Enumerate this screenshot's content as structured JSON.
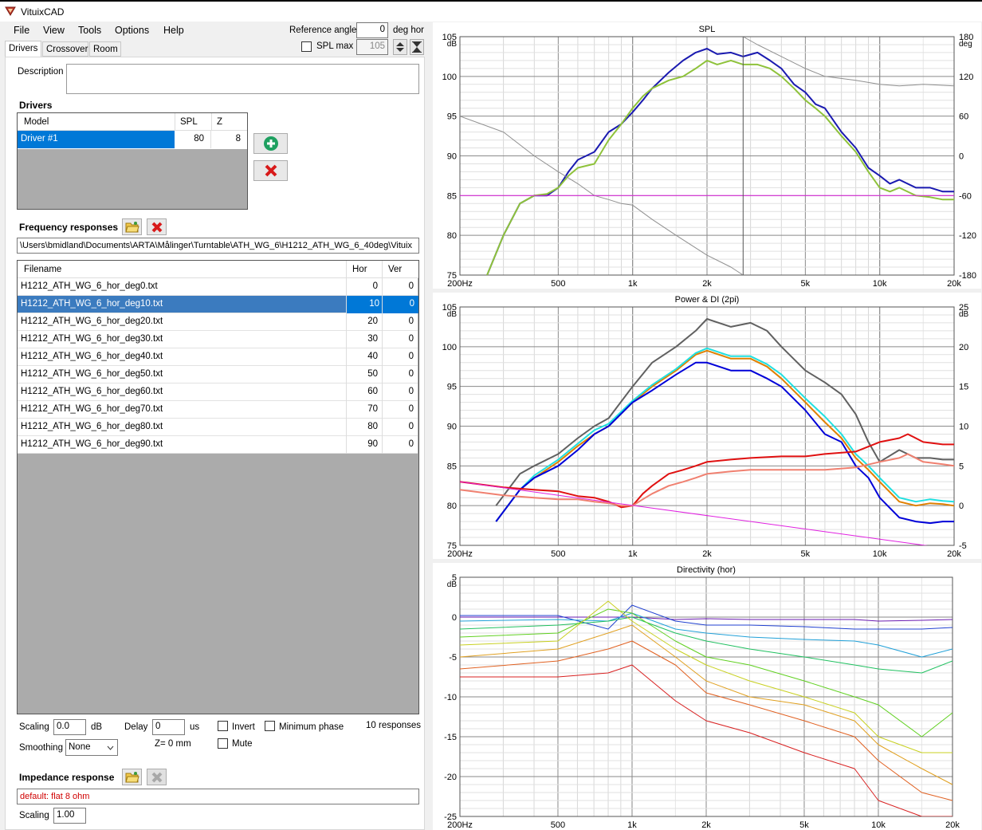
{
  "window": {
    "title": "VituixCAD"
  },
  "menu": [
    "File",
    "View",
    "Tools",
    "Options",
    "Help"
  ],
  "toolbar": {
    "ref_angle_label": "Reference angle",
    "ref_angle_value": "0",
    "ref_angle_unit": "deg hor",
    "spl_max_label": "SPL max",
    "spl_max_value": "105"
  },
  "tabs": [
    "Drivers",
    "Crossover",
    "Room"
  ],
  "description": {
    "label": "Description",
    "value": ""
  },
  "drivers": {
    "heading": "Drivers",
    "columns": [
      "Model",
      "SPL",
      "Z"
    ],
    "rows": [
      {
        "model": "Driver #1",
        "spl": "80",
        "z": "8"
      }
    ]
  },
  "freq": {
    "heading": "Frequency responses",
    "path": "\\Users\\bmidland\\Documents\\ARTA\\Målinger\\Turntable\\ATH_WG_6\\H1212_ATH_WG_6_40deg\\Vituix",
    "columns": [
      "Filename",
      "Hor",
      "Ver"
    ],
    "rows": [
      {
        "file": "H1212_ATH_WG_6_hor_deg0.txt",
        "hor": "0",
        "ver": "0"
      },
      {
        "file": "H1212_ATH_WG_6_hor_deg10.txt",
        "hor": "10",
        "ver": "0"
      },
      {
        "file": "H1212_ATH_WG_6_hor_deg20.txt",
        "hor": "20",
        "ver": "0"
      },
      {
        "file": "H1212_ATH_WG_6_hor_deg30.txt",
        "hor": "30",
        "ver": "0"
      },
      {
        "file": "H1212_ATH_WG_6_hor_deg40.txt",
        "hor": "40",
        "ver": "0"
      },
      {
        "file": "H1212_ATH_WG_6_hor_deg50.txt",
        "hor": "50",
        "ver": "0"
      },
      {
        "file": "H1212_ATH_WG_6_hor_deg60.txt",
        "hor": "60",
        "ver": "0"
      },
      {
        "file": "H1212_ATH_WG_6_hor_deg70.txt",
        "hor": "70",
        "ver": "0"
      },
      {
        "file": "H1212_ATH_WG_6_hor_deg80.txt",
        "hor": "80",
        "ver": "0"
      },
      {
        "file": "H1212_ATH_WG_6_hor_deg90.txt",
        "hor": "90",
        "ver": "0"
      }
    ]
  },
  "controls": {
    "scaling_label": "Scaling",
    "scaling_value": "0.0",
    "scaling_unit": "dB",
    "delay_label": "Delay",
    "delay_value": "0",
    "delay_unit": "us",
    "invert_label": "Invert",
    "minphase_label": "Minimum phase",
    "responses_count": "10 responses",
    "smoothing_label": "Smoothing",
    "smoothing_value": "None",
    "z_text": "Z= 0 mm",
    "mute_label": "Mute"
  },
  "impedance": {
    "heading": "Impedance response",
    "value": "default: flat 8 ohm",
    "scaling_label": "Scaling",
    "scaling_value": "1.00"
  },
  "colors": {
    "accent": "#3b7bbf",
    "selected_driver": "#0078d7",
    "red_text": "#d00000"
  },
  "chart_data": [
    {
      "type": "line",
      "title": "SPL",
      "xscale": "log",
      "xlim": [
        200,
        20000
      ],
      "xticks": [
        "200Hz",
        "500",
        "1k",
        "2k",
        "5k",
        "10k",
        "20k"
      ],
      "ylim": [
        75,
        105
      ],
      "yticks": [
        "105",
        "100",
        "95",
        "90",
        "85",
        "80",
        "75"
      ],
      "yunit": "dB",
      "y2lim": [
        -180,
        180
      ],
      "y2ticks": [
        "180",
        "120",
        "60",
        "0",
        "-60",
        "-120",
        "-180"
      ],
      "y2unit": "deg",
      "series": [
        {
          "color": "#1a1ab0",
          "x": [
            250,
            300,
            350,
            400,
            450,
            500,
            550,
            600,
            700,
            800,
            900,
            1000,
            1100,
            1200,
            1400,
            1600,
            1800,
            2000,
            2200,
            2500,
            2800,
            3200,
            3600,
            4000,
            4500,
            5000,
            5500,
            6000,
            7000,
            8000,
            9000,
            10000,
            11000,
            12000,
            14000,
            16000,
            18000,
            20000
          ],
          "y": [
            74,
            80,
            84,
            85,
            85,
            86,
            88,
            89.5,
            90.5,
            93,
            94,
            95.5,
            97,
            98.5,
            100.5,
            102,
            103,
            103.5,
            102.8,
            103,
            102.5,
            103,
            102,
            101,
            99,
            98,
            96.5,
            96,
            93,
            91,
            88.5,
            87.5,
            86.5,
            87,
            86,
            86,
            85.5,
            85.5
          ]
        },
        {
          "color": "#8ec23a",
          "x": [
            250,
            300,
            350,
            400,
            450,
            500,
            550,
            600,
            700,
            800,
            900,
            1000,
            1100,
            1200,
            1400,
            1600,
            1800,
            2000,
            2200,
            2500,
            2800,
            3200,
            3600,
            4000,
            4500,
            5000,
            5500,
            6000,
            7000,
            8000,
            9000,
            10000,
            11000,
            12000,
            14000,
            16000,
            18000,
            20000
          ],
          "y": [
            74,
            80,
            84,
            85,
            85.2,
            86,
            87.5,
            88.5,
            89,
            92,
            94,
            96,
            97.5,
            98.5,
            99.5,
            100,
            101,
            102,
            101.5,
            102,
            101.5,
            101.5,
            101,
            100,
            98.5,
            97,
            96,
            95,
            92.5,
            90.5,
            88,
            86,
            85.5,
            86,
            85,
            84.8,
            84.5,
            84.5
          ]
        },
        {
          "color": "#909090",
          "x": [
            200,
            300,
            400,
            500,
            600,
            700,
            800,
            900,
            1000,
            1200,
            1500,
            2000,
            2500,
            2800
          ],
          "y": [
            95,
            93,
            90,
            88,
            86.5,
            85,
            84.5,
            84,
            83.8,
            82,
            80,
            77.5,
            76,
            75
          ]
        },
        {
          "color": "#909090",
          "x": [
            2800,
            3200,
            4000,
            5000,
            6000,
            8000,
            10000,
            12000,
            15000,
            20000
          ],
          "y": [
            105,
            104,
            102.5,
            101,
            100,
            99.5,
            99,
            98.8,
            99,
            98.8
          ]
        },
        {
          "color": "#e020e0",
          "x": [
            200,
            20000
          ],
          "y": [
            85,
            85
          ]
        }
      ]
    },
    {
      "type": "line",
      "title": "Power & DI (2pi)",
      "xscale": "log",
      "xlim": [
        200,
        20000
      ],
      "xticks": [
        "200Hz",
        "500",
        "1k",
        "2k",
        "5k",
        "10k",
        "20k"
      ],
      "ylim": [
        75,
        105
      ],
      "yticks": [
        "105",
        "100",
        "95",
        "90",
        "85",
        "80",
        "75"
      ],
      "yunit": "dB",
      "y2lim": [
        -5,
        25
      ],
      "y2ticks": [
        "25",
        "20",
        "15",
        "10",
        "5",
        "0",
        "-5"
      ],
      "y2unit": "dB",
      "series": [
        {
          "color": "#606060",
          "x": [
            280,
            350,
            400,
            500,
            600,
            700,
            800,
            1000,
            1200,
            1500,
            1800,
            2000,
            2500,
            3000,
            3500,
            4000,
            5000,
            6000,
            7000,
            8000,
            9000,
            10000,
            12000,
            14000,
            16000,
            18000,
            20000
          ],
          "y": [
            80,
            84,
            85,
            86.5,
            88.5,
            90,
            91,
            95,
            98,
            100,
            102,
            103.5,
            102.5,
            103,
            102,
            100,
            97,
            95.5,
            94,
            91.5,
            88,
            85.5,
            87,
            86,
            86,
            85.8,
            85.8
          ]
        },
        {
          "color": "#e08000",
          "x": [
            280,
            350,
            400,
            500,
            600,
            700,
            800,
            1000,
            1200,
            1500,
            1800,
            2000,
            2500,
            3000,
            3500,
            4000,
            5000,
            6000,
            7000,
            8000,
            9000,
            10000,
            12000,
            14000,
            16000,
            18000,
            20000
          ],
          "y": [
            78,
            82,
            83.5,
            85.5,
            87.5,
            89,
            90,
            93,
            95,
            97,
            99,
            99.5,
            98.5,
            98.5,
            97.5,
            96,
            93,
            90.5,
            88.5,
            86,
            84.5,
            83,
            80.5,
            80,
            80.3,
            80.2,
            80
          ]
        },
        {
          "color": "#20e0e0",
          "x": [
            280,
            350,
            400,
            500,
            600,
            700,
            800,
            1000,
            1200,
            1500,
            1800,
            2000,
            2500,
            3000,
            3500,
            4000,
            5000,
            6000,
            7000,
            8000,
            9000,
            10000,
            12000,
            14000,
            16000,
            18000,
            20000
          ],
          "y": [
            78,
            82,
            83.8,
            85.8,
            87.8,
            89.5,
            90.3,
            93.2,
            95.2,
            97.2,
            99.2,
            99.8,
            98.8,
            98.8,
            97.8,
            96.5,
            93.5,
            91.2,
            89,
            86.5,
            85,
            83.5,
            81,
            80.5,
            80.8,
            80.6,
            80.5
          ]
        },
        {
          "color": "#0000d8",
          "x": [
            280,
            350,
            400,
            500,
            600,
            700,
            800,
            1000,
            1200,
            1500,
            1800,
            2000,
            2500,
            3000,
            3500,
            4000,
            5000,
            6000,
            7000,
            8000,
            9000,
            10000,
            12000,
            14000,
            16000,
            18000,
            20000
          ],
          "y": [
            78,
            82,
            83.5,
            85,
            87,
            89,
            90,
            93,
            94.5,
            96.5,
            98,
            98,
            97,
            97,
            96,
            95,
            92,
            89,
            88,
            85,
            83.5,
            81,
            78.5,
            78,
            77.8,
            78,
            78
          ]
        },
        {
          "color": "#e01010",
          "x": [
            200,
            300,
            400,
            500,
            600,
            700,
            800,
            900,
            1000,
            1100,
            1200,
            1400,
            1600,
            1800,
            2000,
            2500,
            3000,
            4000,
            5000,
            6000,
            8000,
            10000,
            12000,
            13000,
            15000,
            18000,
            20000
          ],
          "y": [
            83,
            82.3,
            82,
            81.8,
            81.2,
            81,
            80.5,
            79.8,
            80,
            81.5,
            82.5,
            84,
            84.5,
            85,
            85.5,
            85.8,
            86,
            86.2,
            86.2,
            86.5,
            86.8,
            88,
            88.5,
            89,
            88,
            87.7,
            87.7
          ]
        },
        {
          "color": "#f08070",
          "x": [
            200,
            300,
            400,
            500,
            600,
            700,
            800,
            900,
            1000,
            1100,
            1200,
            1400,
            1600,
            1800,
            2000,
            2500,
            3000,
            4000,
            5000,
            6000,
            8000,
            10000,
            12000,
            13000,
            15000,
            18000,
            20000
          ],
          "y": [
            82,
            81.3,
            81,
            80.8,
            80.8,
            80.5,
            80.3,
            80,
            80,
            80.8,
            81.5,
            82.5,
            83,
            83.5,
            84,
            84.3,
            84.5,
            84.5,
            84.5,
            84.5,
            84.8,
            85.5,
            86,
            86.5,
            85.5,
            85.2,
            85
          ]
        },
        {
          "color": "#e020e0",
          "x": [
            200,
            20000
          ],
          "y": [
            83,
            74.5
          ]
        }
      ]
    },
    {
      "type": "line",
      "title": "Directivity (hor)",
      "xscale": "log",
      "xlim": [
        200,
        20000
      ],
      "xticks": [
        "200Hz",
        "500",
        "1k",
        "2k",
        "5k",
        "10k",
        "20k"
      ],
      "ylim": [
        -25,
        5
      ],
      "yticks": [
        "5",
        "0",
        "-5",
        "-10",
        "-15",
        "-20",
        "-25"
      ],
      "yunit": "dB",
      "series": [
        {
          "color": "#6a1ab0",
          "x": [
            200,
            500,
            800,
            1000,
            1500,
            2000,
            3000,
            5000,
            8000,
            10000,
            15000,
            20000
          ],
          "y": [
            0,
            0,
            0,
            0,
            -0.3,
            -0.2,
            -0.3,
            -0.3,
            -0.3,
            -0.5,
            -0.4,
            -0.3
          ]
        },
        {
          "color": "#2040d0",
          "x": [
            200,
            500,
            800,
            1000,
            1500,
            2000,
            3000,
            5000,
            8000,
            10000,
            15000,
            20000
          ],
          "y": [
            0.2,
            0.2,
            -1.5,
            1.5,
            -0.5,
            -1,
            -1,
            -1.2,
            -1.5,
            -1.5,
            -1.5,
            -1.3
          ]
        },
        {
          "color": "#20a0d8",
          "x": [
            200,
            500,
            800,
            1000,
            1500,
            2000,
            3000,
            5000,
            8000,
            10000,
            15000,
            20000
          ],
          "y": [
            -0.5,
            -0.3,
            -0.5,
            0.5,
            -1.5,
            -2,
            -2.5,
            -2.8,
            -3,
            -3.5,
            -5,
            -4
          ]
        },
        {
          "color": "#20c060",
          "x": [
            200,
            500,
            800,
            1000,
            1500,
            2000,
            3000,
            5000,
            8000,
            10000,
            15000,
            20000
          ],
          "y": [
            -1.5,
            -1,
            -0.5,
            0,
            -2,
            -3,
            -4,
            -5,
            -6,
            -6.5,
            -7,
            -5.5
          ]
        },
        {
          "color": "#60d020",
          "x": [
            200,
            500,
            800,
            1000,
            1500,
            2000,
            3000,
            5000,
            8000,
            10000,
            15000,
            20000
          ],
          "y": [
            -2.5,
            -2,
            1,
            0.5,
            -3,
            -5,
            -6,
            -8,
            -10,
            -11,
            -15,
            -12
          ]
        },
        {
          "color": "#c8d020",
          "x": [
            200,
            500,
            800,
            1000,
            1500,
            2000,
            3000,
            5000,
            8000,
            10000,
            15000,
            20000
          ],
          "y": [
            -3.5,
            -3,
            2,
            -0.5,
            -4,
            -6,
            -8,
            -10,
            -12,
            -15,
            -17,
            -17
          ]
        },
        {
          "color": "#e0a020",
          "x": [
            200,
            500,
            800,
            1000,
            1500,
            2000,
            3000,
            5000,
            8000,
            10000,
            15000,
            20000
          ],
          "y": [
            -5,
            -4,
            -2,
            -1,
            -5,
            -8,
            -10,
            -11,
            -13,
            -16,
            -19,
            -21
          ]
        },
        {
          "color": "#e06020",
          "x": [
            200,
            500,
            800,
            1000,
            1500,
            2000,
            3000,
            5000,
            8000,
            10000,
            15000,
            20000
          ],
          "y": [
            -6.5,
            -5.5,
            -4,
            -3,
            -6,
            -9.5,
            -11,
            -13,
            -15,
            -18,
            -22,
            -23
          ]
        },
        {
          "color": "#d82020",
          "x": [
            200,
            500,
            800,
            1000,
            1500,
            2000,
            3000,
            5000,
            8000,
            10000,
            15000,
            20000
          ],
          "y": [
            -7.5,
            -7.5,
            -7,
            -6,
            -10.5,
            -13,
            -14.5,
            -17,
            -19,
            -23,
            -25,
            -25
          ]
        }
      ]
    }
  ]
}
